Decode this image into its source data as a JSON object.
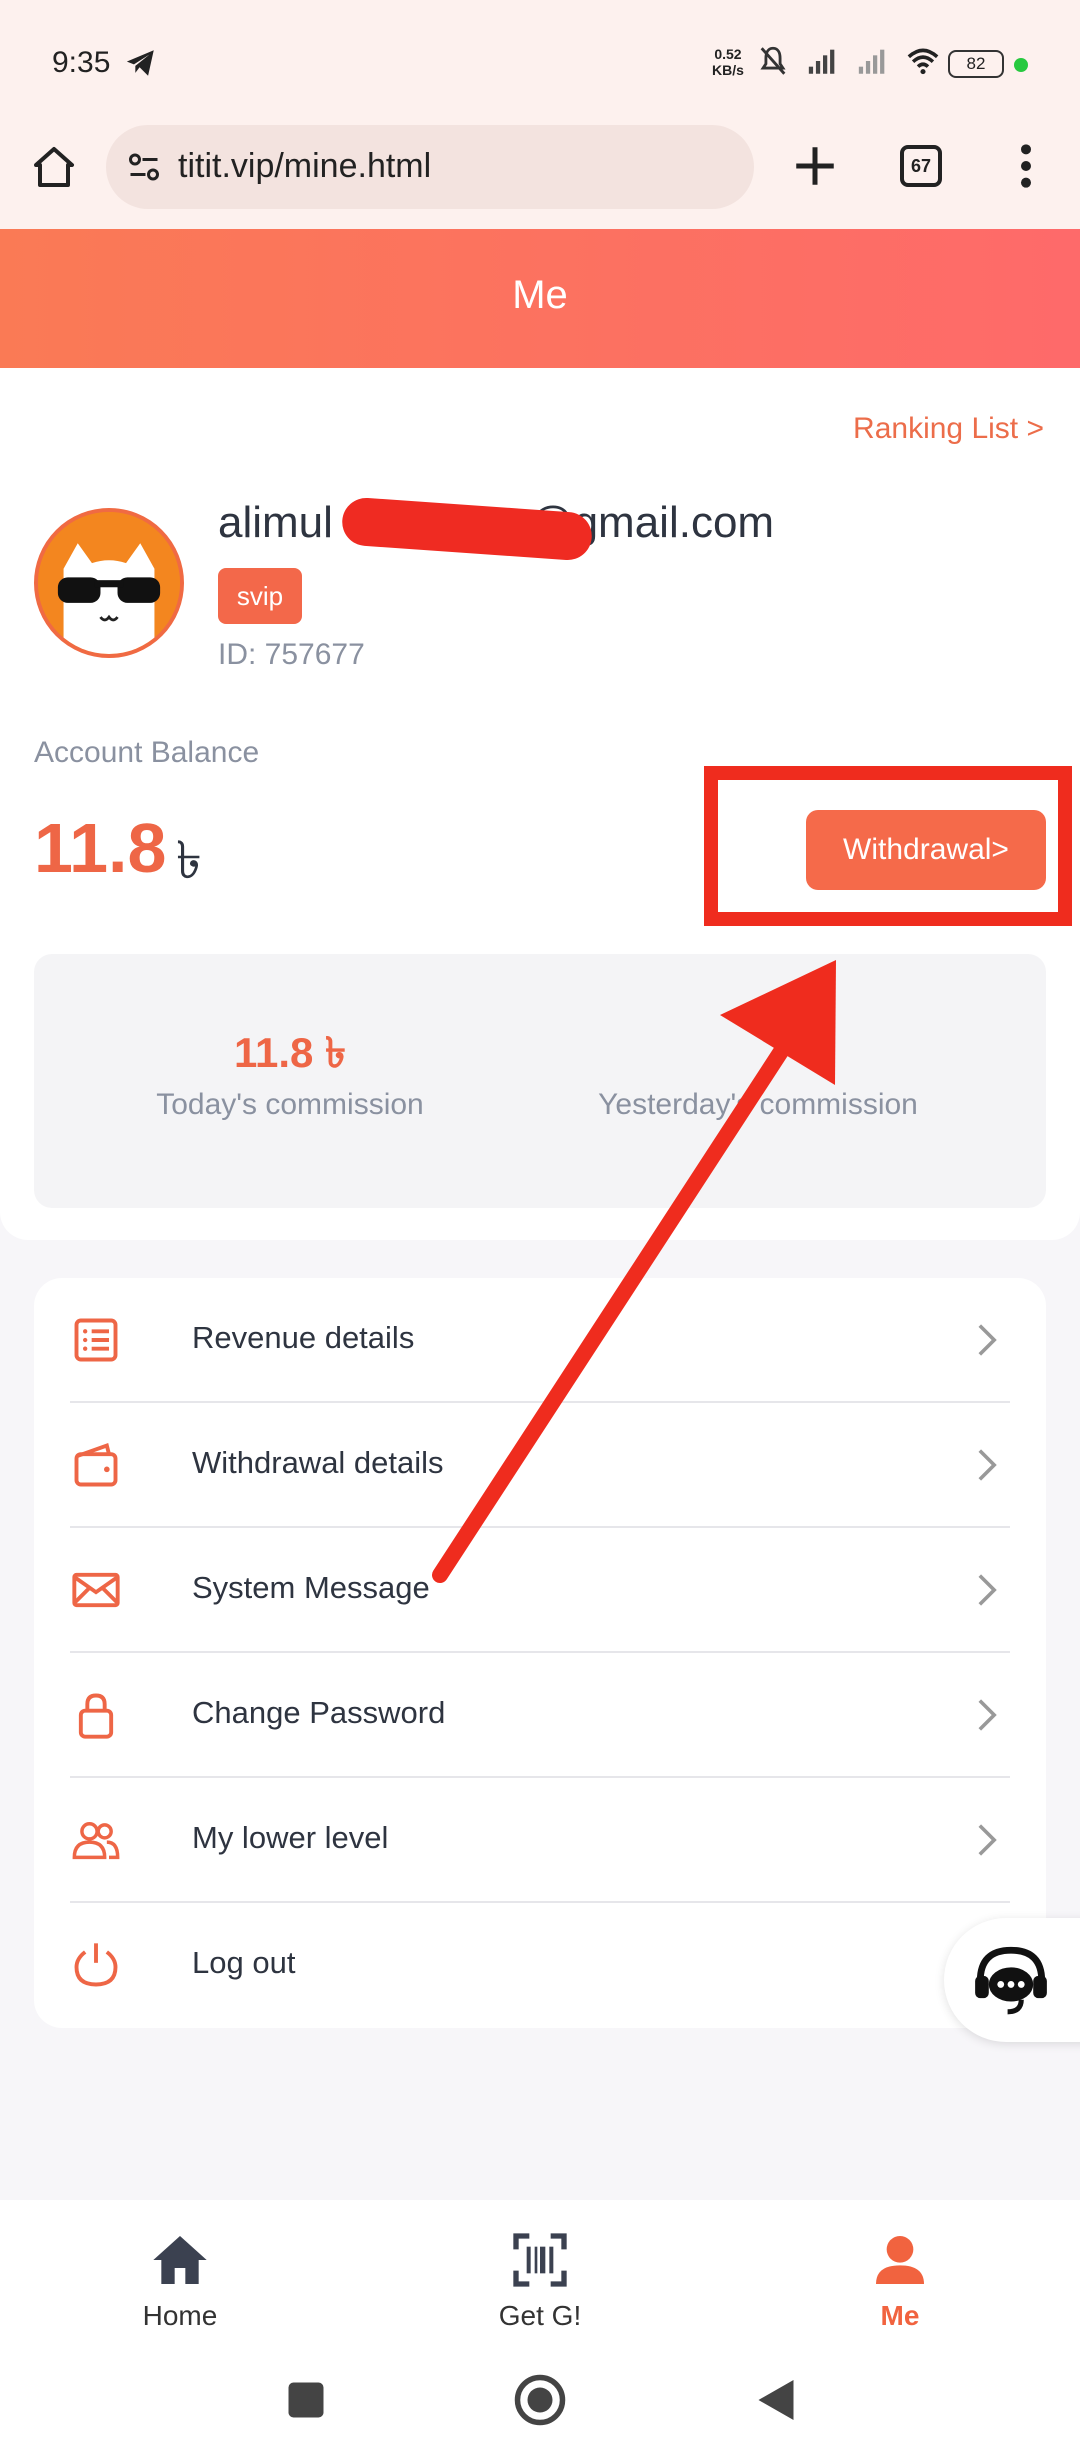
{
  "status_bar": {
    "time": "9:35",
    "speed": "0.52",
    "speed_unit": "KB/s",
    "battery": "82"
  },
  "browser": {
    "url": "titit.vip/mine.html",
    "tab_count": "67"
  },
  "header": {
    "title": "Me"
  },
  "profile": {
    "ranking_link": "Ranking List  >",
    "email_visible_start": "alimul",
    "email_visible_end": "@gmail.com",
    "vip_badge": "svip",
    "user_id": "ID:  757677"
  },
  "balance": {
    "label": "Account Balance",
    "value": "11.8",
    "currency": "৳",
    "withdraw_button": "Withdrawal>"
  },
  "commission": {
    "today_value": "11.8 ৳",
    "today_label": "Today's commission",
    "yesterday_value": "",
    "yesterday_label": "Yesterday's commission"
  },
  "menu": {
    "items": [
      {
        "label": "Revenue details",
        "icon": "list-icon"
      },
      {
        "label": "Withdrawal details",
        "icon": "wallet-icon"
      },
      {
        "label": "System Message",
        "icon": "mail-icon"
      },
      {
        "label": "Change Password",
        "icon": "lock-icon"
      },
      {
        "label": "My lower level",
        "icon": "users-icon"
      },
      {
        "label": "Log out",
        "icon": "power-icon"
      }
    ]
  },
  "bottom_nav": {
    "items": [
      {
        "label": "Home",
        "icon": "home-icon"
      },
      {
        "label": "Get G!",
        "icon": "scan-icon"
      },
      {
        "label": "Me",
        "icon": "person-icon",
        "active": true
      }
    ]
  },
  "colors": {
    "accent": "#f56a4a",
    "annotation": "#ef2c1e"
  }
}
